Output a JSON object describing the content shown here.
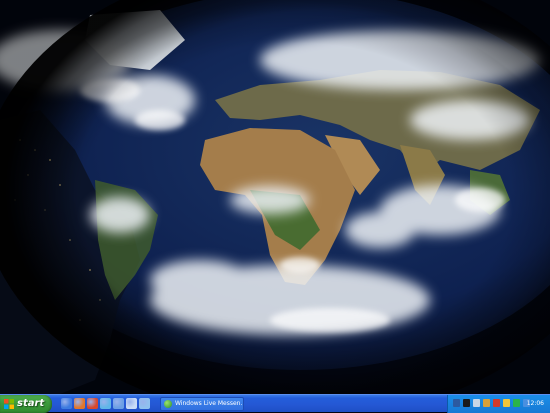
{
  "desktop": {
    "wallpaper": "world-map-day-night",
    "colors": {
      "ocean": "#0b1a3a",
      "night": "#020612",
      "land": "#9c7a4a",
      "cloud": "#eef2f6"
    }
  },
  "taskbar": {
    "start_label": "start",
    "quick_launch": [
      {
        "icon": "ie-icon",
        "color": "#3d7be0"
      },
      {
        "icon": "firefox-icon",
        "color": "#e2762a"
      },
      {
        "icon": "media-player-icon",
        "color": "#d9472b"
      },
      {
        "icon": "messenger-icon",
        "color": "#5fb6e8"
      },
      {
        "icon": "outlook-icon",
        "color": "#6b9fe5"
      },
      {
        "icon": "show-desktop-icon",
        "color": "#c9dcf7"
      },
      {
        "icon": "browser-icon",
        "color": "#8fc1ef"
      }
    ],
    "task_button": "Windows Live Messen...",
    "tray_icons": [
      {
        "icon": "network-icon",
        "color": "#2c5aa0"
      },
      {
        "icon": "antivirus-icon",
        "color": "#1b1b1b"
      },
      {
        "icon": "volume-icon",
        "color": "#c9d6e6"
      },
      {
        "icon": "messenger-tray-icon",
        "color": "#d8a03a"
      },
      {
        "icon": "security-icon",
        "color": "#d23a2a"
      },
      {
        "icon": "update-icon",
        "color": "#f2c53a"
      },
      {
        "icon": "battery-icon",
        "color": "#2bb34a"
      },
      {
        "icon": "app-icon",
        "color": "#4a8fe0"
      }
    ],
    "clock": "12:06"
  }
}
